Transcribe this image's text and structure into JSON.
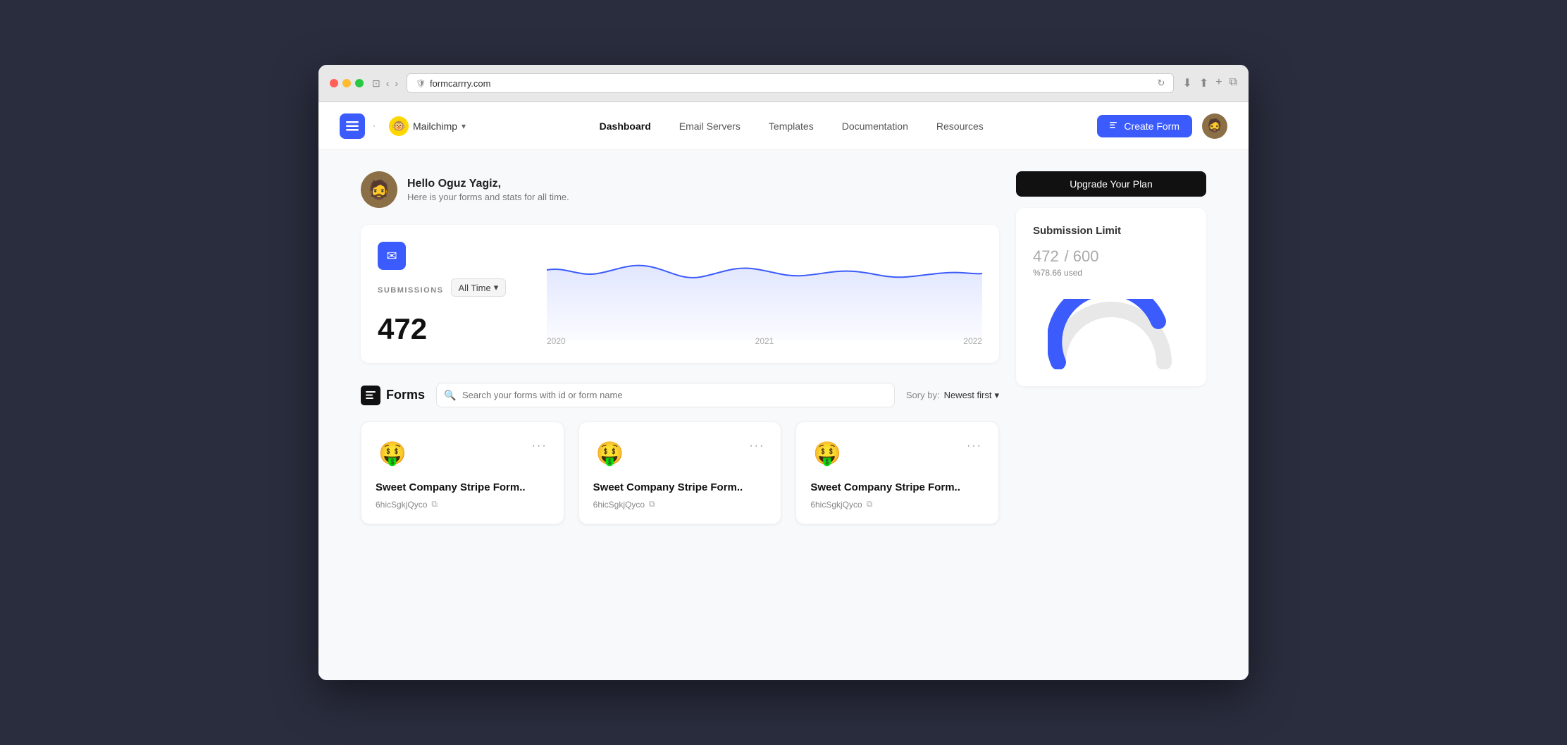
{
  "browser": {
    "url": "formcarrry.com",
    "traffic_lights": [
      "red",
      "yellow",
      "green"
    ]
  },
  "nav": {
    "logo_icon": "≡",
    "account_name": "Mailchimp",
    "account_emoji": "🐵",
    "links": [
      {
        "label": "Dashboard",
        "active": true
      },
      {
        "label": "Email Servers",
        "active": false
      },
      {
        "label": "Templates",
        "active": false
      },
      {
        "label": "Documentation",
        "active": false
      },
      {
        "label": "Resources",
        "active": false
      }
    ],
    "create_form_label": "Create Form",
    "user_emoji": "🧔"
  },
  "greeting": {
    "name": "Hello Oguz Yagiz,",
    "subtitle": "Here is your forms and stats for all time.",
    "avatar_emoji": "🧔"
  },
  "stats": {
    "icon": "✉",
    "label": "SUBMISSIONS",
    "filter": "All Time",
    "count": "472",
    "chart_years": [
      "2020",
      "2021",
      "2022"
    ]
  },
  "forms_section": {
    "title": "Forms",
    "search_placeholder": "Search your forms with id or form name",
    "sort_label": "Sory by:",
    "sort_value": "Newest first",
    "cards": [
      {
        "emoji": "🤑",
        "name": "Sweet Company Stripe Form..",
        "id": "6hicSgkjQyco"
      },
      {
        "emoji": "🤑",
        "name": "Sweet Company Stripe Form..",
        "id": "6hicSgkjQyco"
      },
      {
        "emoji": "🤑",
        "name": "Sweet Company Stripe Form..",
        "id": "6hicSgkjQyco"
      }
    ]
  },
  "sidebar": {
    "upgrade_label": "Upgrade Your Plan",
    "plan_title": "Submission Limit",
    "plan_used": "472",
    "plan_total": "600",
    "plan_percent": "78.66",
    "plan_used_text": "%78.66 used"
  }
}
